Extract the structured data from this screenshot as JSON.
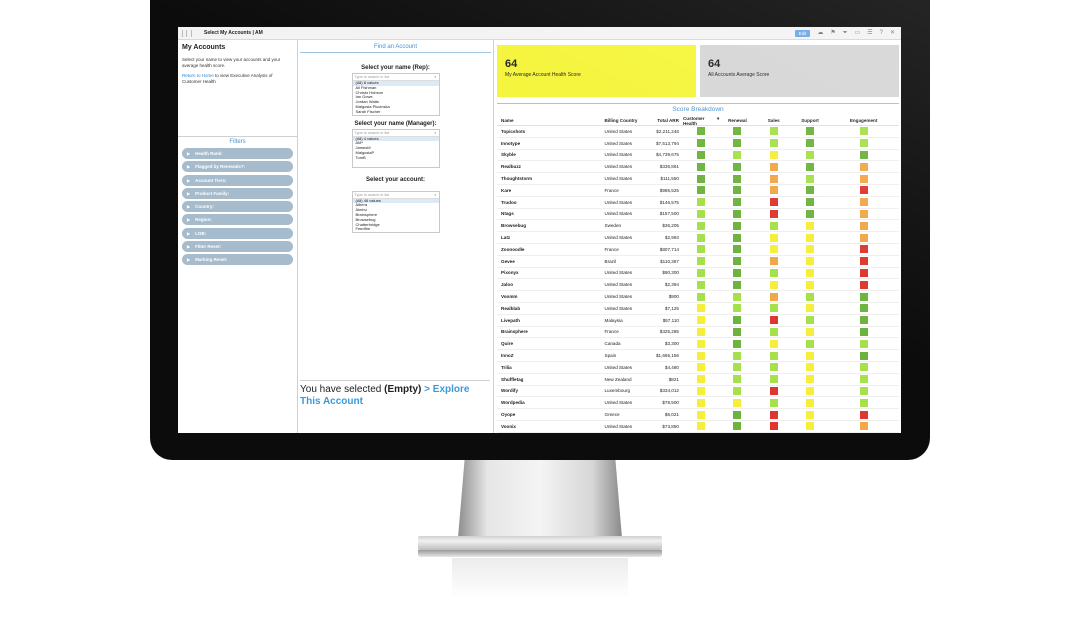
{
  "window": {
    "title": "Select My Accounts | AM",
    "edit_label": "Edit"
  },
  "toolbar_icons": [
    "share-icon",
    "bookmark-icon",
    "filter-icon",
    "device-icon",
    "menu-icon",
    "help-icon",
    "close-icon"
  ],
  "left": {
    "title": "My Accounts",
    "description": "Select your name to view your accounts and your average health score.",
    "return_link": "Return to Home",
    "return_text": " to view Executive Analysis of Customer Health",
    "filters_title": "Filters",
    "filters": [
      "Health Rank:",
      "Flagged by Renewals?:",
      "Account Tiers:",
      "Product Family:",
      "Country:",
      "Region:",
      "LOB:",
      "Filter Reset:",
      "Marking Reset:"
    ]
  },
  "middle": {
    "title": "Find an Account",
    "rep_label": "Select your name (Rep):",
    "rep_search": "Type to search in list",
    "rep_items": [
      "(All) 8 values",
      "Ali Fishman",
      "Christo Hobson",
      "Ian Gowe",
      "Jordan Watts",
      "Malgosia Plucinska",
      "Sarah Fischer"
    ],
    "mgr_label": "Select your name (Manager):",
    "mgr_search": "Type to search in list",
    "mgr_items": [
      "(All) 4 values",
      "AM*",
      "JamesM",
      "MalgosiaP",
      "TomB"
    ],
    "acct_label": "Select your account:",
    "acct_search": "Type to search in list",
    "acct_items": [
      "(All) 46 values",
      "Aibera",
      "Aimbu",
      "Brainsphere",
      "Browsebug",
      "Chatterbridge",
      "Feedfire"
    ],
    "selected_prefix": "You have selected ",
    "selected_value": "(Empty)",
    "explore_label": "> Explore This Account"
  },
  "kpis": [
    {
      "value": "64",
      "label": "My Average Account Health Score",
      "color": "#f5f53a"
    },
    {
      "value": "64",
      "label": "All Accounts Average Score",
      "color": "#d6d6d6"
    }
  ],
  "score_breakdown": {
    "title": "Score Breakdown",
    "columns": [
      "Name",
      "Billing Country",
      "Total ARR",
      "Customer Health",
      "Renewal",
      "Sales",
      "Support",
      "Engagement"
    ],
    "sort_indicator": "▾",
    "colors": {
      "dg": "#6db33f",
      "lg": "#a6e04a",
      "yl": "#f5ee3a",
      "or": "#f0a848",
      "rd": "#dd3730"
    },
    "rows": [
      [
        "Topicshots",
        "United States",
        "$2,211,248",
        "dg",
        "dg",
        "lg",
        "dg",
        "lg"
      ],
      [
        "Innotype",
        "United States",
        "$7,513,794",
        "dg",
        "dg",
        "lg",
        "dg",
        "lg"
      ],
      [
        "Skyble",
        "United States",
        "$4,739,675",
        "dg",
        "lg",
        "yl",
        "lg",
        "dg"
      ],
      [
        "Realbuzz",
        "United States",
        "$336,861",
        "dg",
        "dg",
        "or",
        "dg",
        "or"
      ],
      [
        "Thoughtstorm",
        "United States",
        "$111,550",
        "dg",
        "dg",
        "or",
        "lg",
        "or"
      ],
      [
        "Kare",
        "France",
        "$985,525",
        "dg",
        "dg",
        "or",
        "dg",
        "rd"
      ],
      [
        "Trudoo",
        "United States",
        "$146,575",
        "lg",
        "dg",
        "rd",
        "dg",
        "or"
      ],
      [
        "Ntags",
        "United States",
        "$157,500",
        "lg",
        "dg",
        "rd",
        "dg",
        "or"
      ],
      [
        "Browsebug",
        "Sweden",
        "$36,205",
        "lg",
        "dg",
        "lg",
        "yl",
        "or"
      ],
      [
        "Latz",
        "United States",
        "$2,993",
        "lg",
        "dg",
        "yl",
        "yl",
        "or"
      ],
      [
        "Zoonoodle",
        "France",
        "$807,714",
        "lg",
        "dg",
        "yl",
        "yl",
        "rd"
      ],
      [
        "Gevee",
        "Brazil",
        "$110,367",
        "lg",
        "dg",
        "or",
        "yl",
        "rd"
      ],
      [
        "Pixonyx",
        "United States",
        "$90,300",
        "lg",
        "dg",
        "lg",
        "yl",
        "rd"
      ],
      [
        "Jaloo",
        "United States",
        "$2,394",
        "lg",
        "dg",
        "yl",
        "yl",
        "rd"
      ],
      [
        "Voomm",
        "United States",
        "$900",
        "lg",
        "lg",
        "or",
        "lg",
        "dg"
      ],
      [
        "Realblab",
        "United States",
        "$7,125",
        "yl",
        "lg",
        "lg",
        "yl",
        "dg"
      ],
      [
        "Livepath",
        "Malaysia",
        "$57,110",
        "yl",
        "dg",
        "rd",
        "lg",
        "dg"
      ],
      [
        "Brainsphere",
        "France",
        "$325,285",
        "yl",
        "dg",
        "lg",
        "yl",
        "dg"
      ],
      [
        "Quire",
        "Canada",
        "$3,300",
        "yl",
        "dg",
        "yl",
        "lg",
        "lg"
      ],
      [
        "InnoZ",
        "Spain",
        "$1,665,156",
        "yl",
        "lg",
        "lg",
        "yl",
        "dg"
      ],
      [
        "Trilia",
        "United States",
        "$4,480",
        "yl",
        "lg",
        "lg",
        "yl",
        "lg"
      ],
      [
        "Shuffletag",
        "New Zealand",
        "$821",
        "yl",
        "lg",
        "lg",
        "yl",
        "lg"
      ],
      [
        "Wordify",
        "Luxembourg",
        "$334,012",
        "yl",
        "lg",
        "rd",
        "yl",
        "lg"
      ],
      [
        "Wordpedia",
        "United States",
        "$78,500",
        "yl",
        "yl",
        "lg",
        "yl",
        "lg"
      ],
      [
        "Oyope",
        "Greece",
        "$6,021",
        "yl",
        "dg",
        "rd",
        "yl",
        "rd"
      ],
      [
        "Voonix",
        "United States",
        "$73,850",
        "yl",
        "dg",
        "rd",
        "yl",
        "or"
      ],
      [
        "Npath",
        "Switzerland",
        "$14,228",
        "yl",
        "dg",
        "rd",
        "yl",
        "or"
      ],
      [
        "Quinu",
        "Italy",
        "$695,166",
        "yl",
        "lg",
        "lg",
        "yl",
        "rd"
      ],
      [
        "Twinte",
        "Japan",
        "$2,801",
        "yl",
        "dg",
        "lg",
        "rd",
        "rd"
      ]
    ]
  }
}
